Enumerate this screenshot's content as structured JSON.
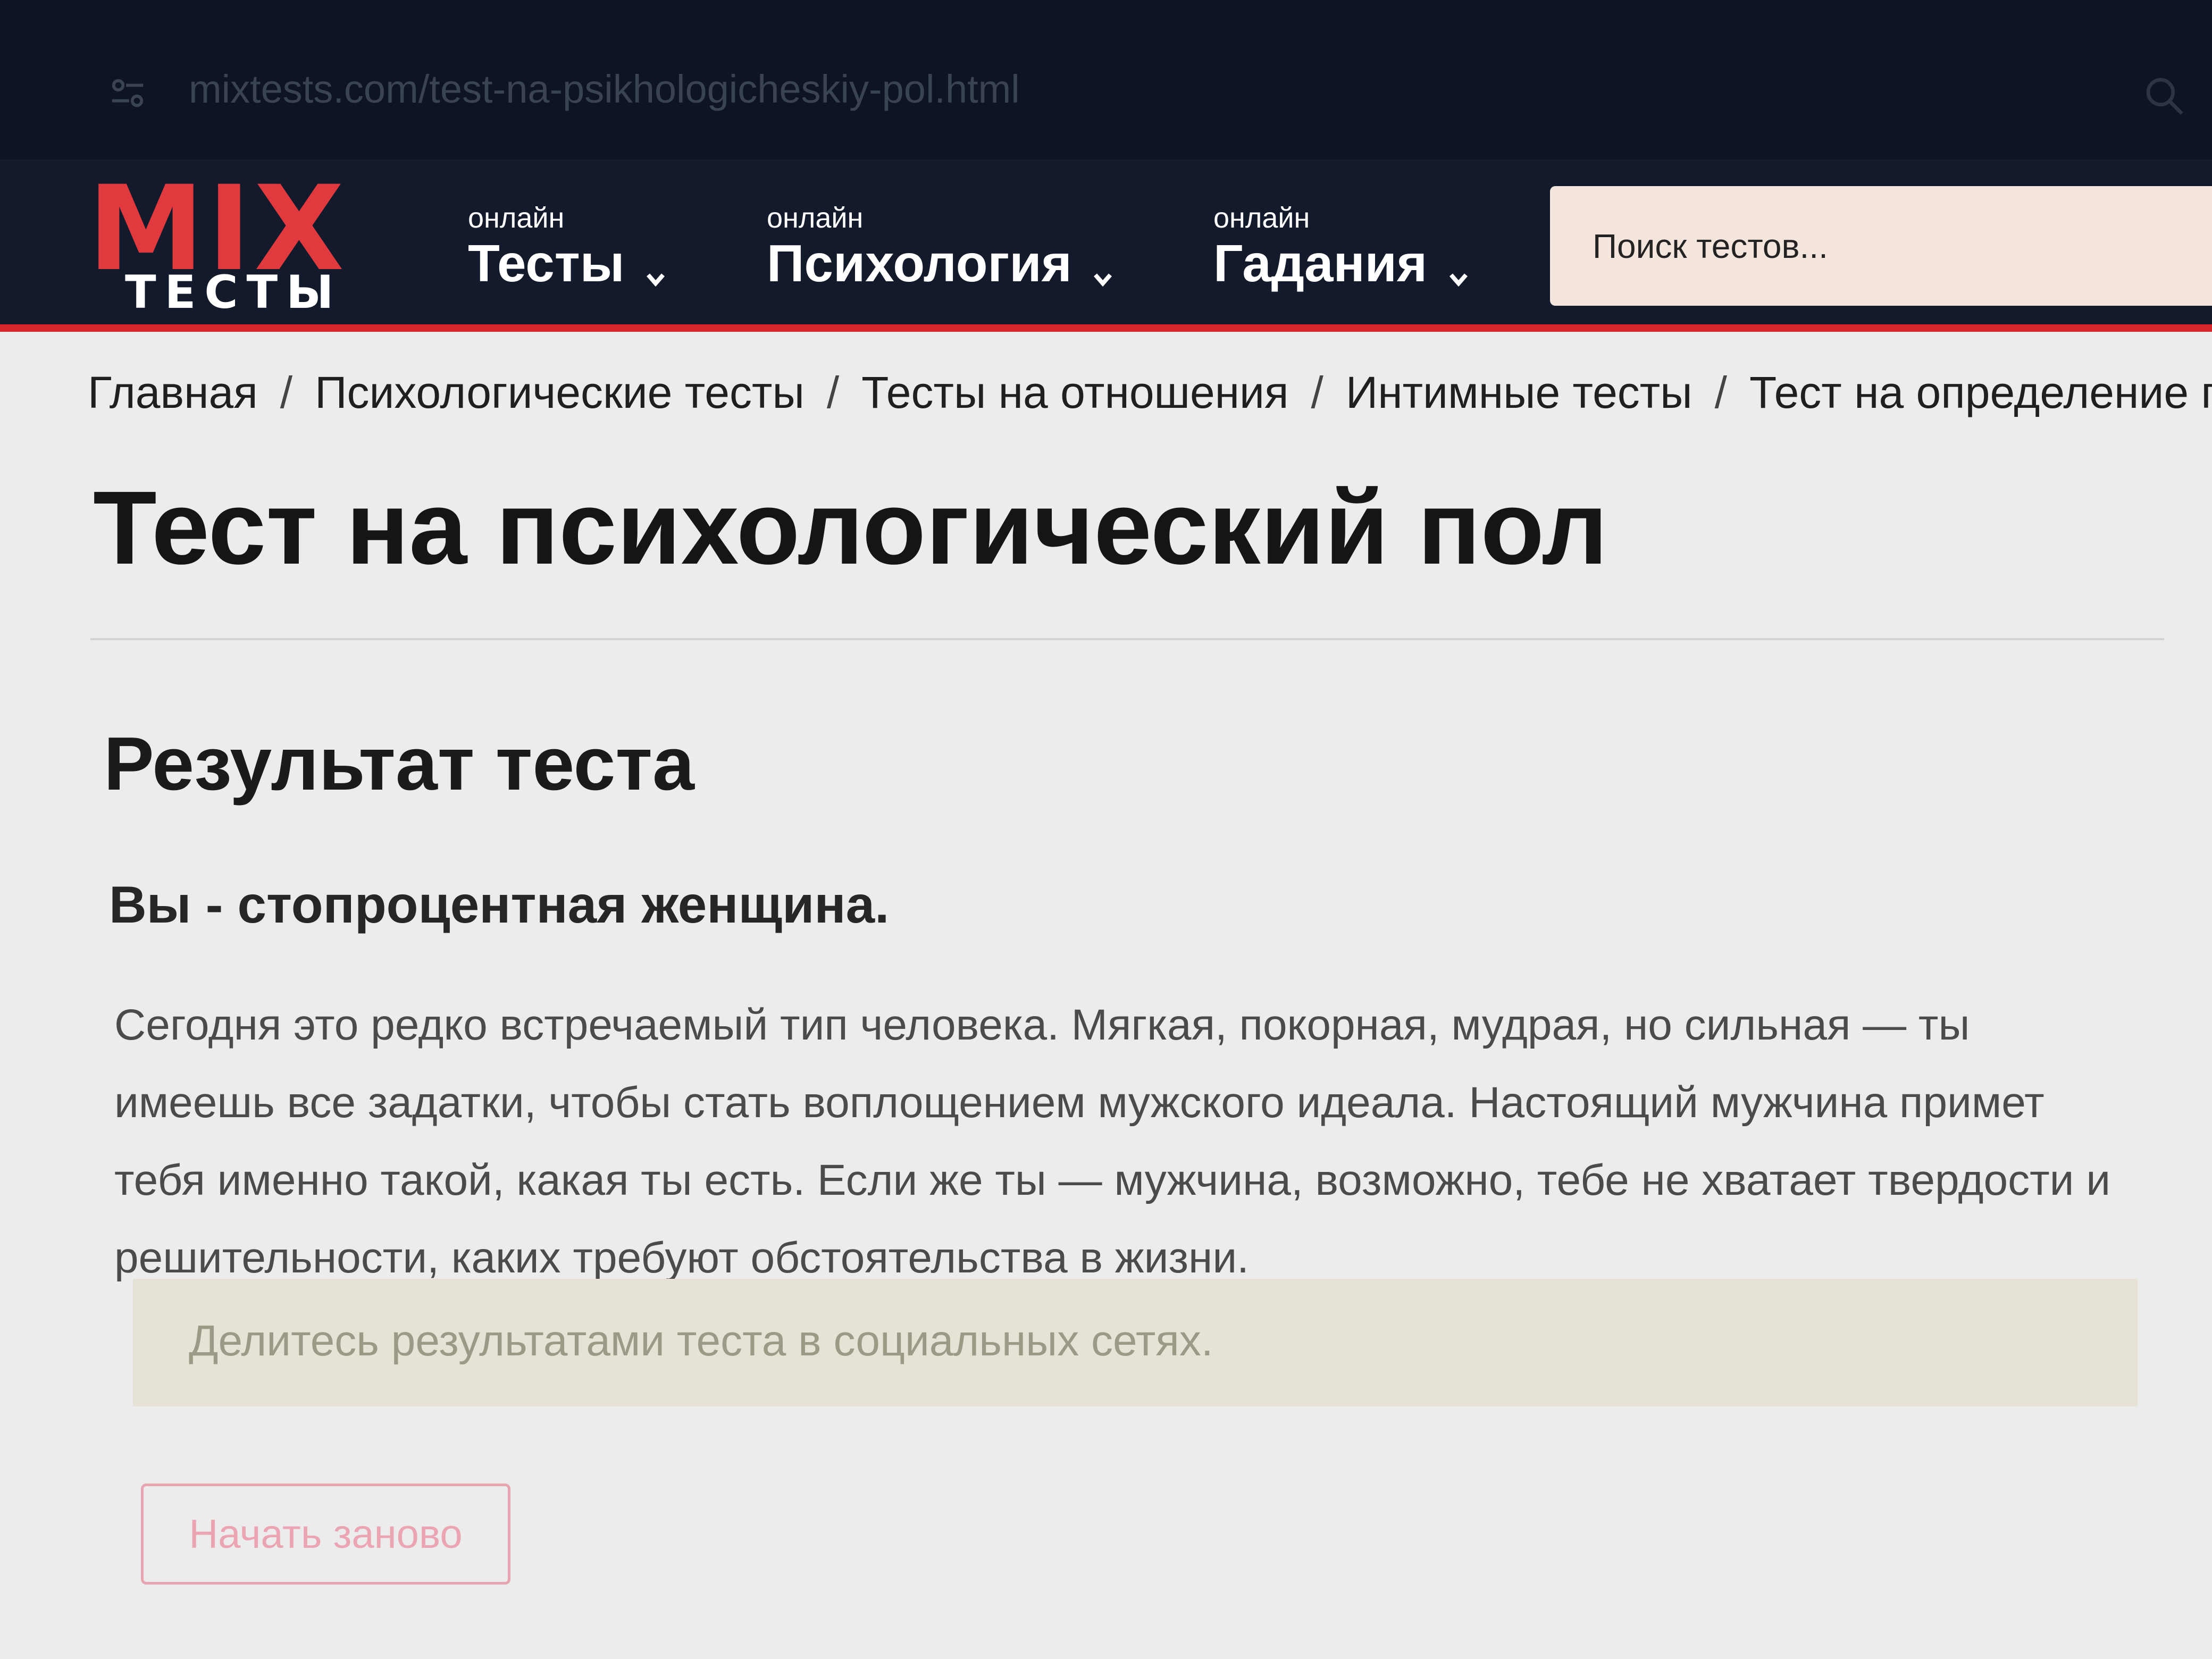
{
  "browser": {
    "url": "mixtests.com/test-na-psikhologicheskiy-pol.html"
  },
  "header": {
    "logo": {
      "mix": "MIX",
      "tests": "ТЕСТЫ"
    },
    "nav": [
      {
        "kicker": "онлайн",
        "label": "Тесты"
      },
      {
        "kicker": "онлайн",
        "label": "Психология"
      },
      {
        "kicker": "онлайн",
        "label": "Гадания"
      }
    ],
    "search_placeholder": "Поиск тестов..."
  },
  "breadcrumb": {
    "items": [
      "Главная",
      "Психологические тесты",
      "Тесты на отношения",
      "Интимные тесты",
      "Тест на определение психо"
    ],
    "separator": "/"
  },
  "page": {
    "title": "Тест на психологический пол"
  },
  "result": {
    "heading": "Результат теста",
    "title": "Вы - стопроцентная женщина.",
    "text": "Сегодня это редко встречаемый тип человека. Мягкая, покорная, мудрая, но сильная — ты имеешь все задатки, чтобы стать воплощением мужского идеала. Настоящий мужчина примет тебя именно такой, какая ты есть. Если же ты — мужчина, возможно, тебе не хватает твердости и решительности, каких требуют обстоятельства в жизни.",
    "share_text": "Делитесь результатами теста в социальных сетях.",
    "restart_label": "Начать заново"
  },
  "icons": {
    "site_settings": "site-settings-icon",
    "zoom": "zoom-icon",
    "chevron": "chevron-down-icon"
  },
  "colors": {
    "header_bg": "#131a2b",
    "accent_red": "#d5272b",
    "logo_red": "#e0393e",
    "search_bg": "#f4e6dd",
    "restart_pink": "#eba4b2"
  }
}
